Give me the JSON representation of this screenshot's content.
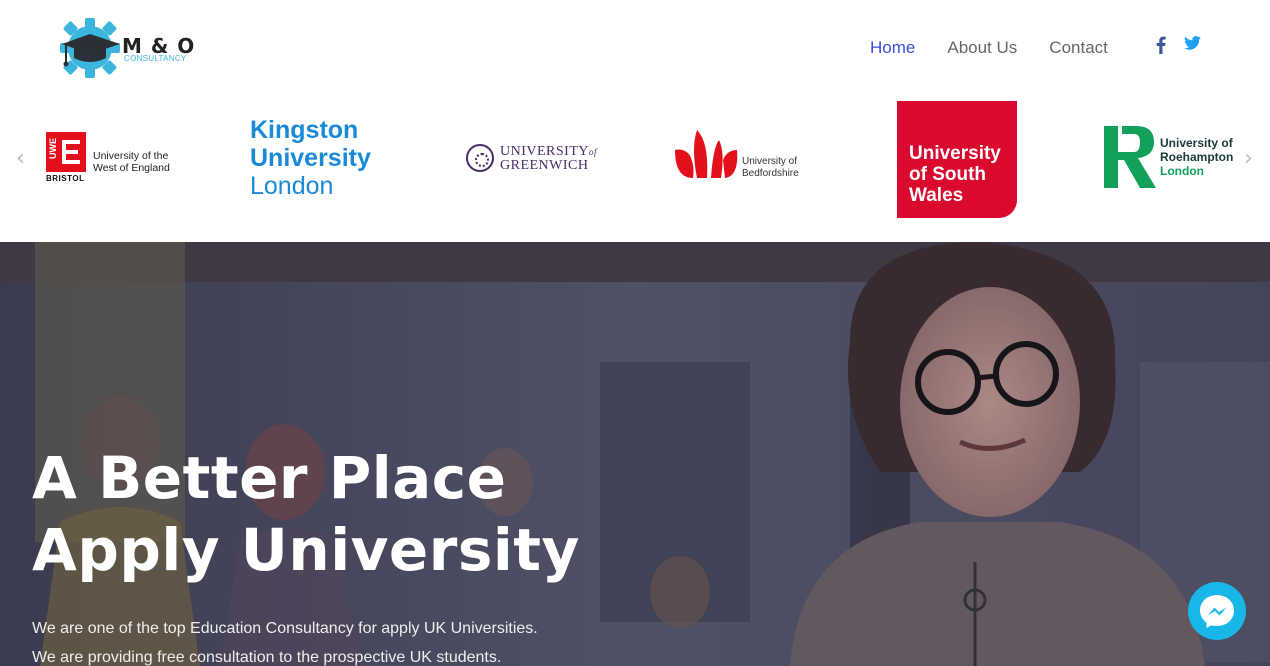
{
  "header": {
    "logo": {
      "title": "M & O",
      "subtitle": "CONSULTANCY"
    },
    "nav": [
      {
        "label": "Home",
        "active": true
      },
      {
        "label": "About Us",
        "active": false
      },
      {
        "label": "Contact",
        "active": false
      }
    ],
    "social": [
      {
        "icon": "facebook-icon",
        "color": "#3b5998"
      },
      {
        "icon": "twitter-icon",
        "color": "#1da1f2"
      }
    ]
  },
  "carousel": {
    "universities": [
      {
        "crest": "UWE",
        "city": "BRISTOL",
        "name_line1": "University of the",
        "name_line2": "West of England"
      },
      {
        "line1": "Kingston",
        "line2": "University",
        "line3": "London"
      },
      {
        "line1": "UNIVERSITY",
        "of": "of",
        "line2": "GREENWICH"
      },
      {
        "line1": "University of",
        "line2": "Bedfordshire"
      },
      {
        "line1": "University",
        "line2": "of South",
        "line3": "Wales"
      },
      {
        "line1": "University of",
        "line2": "Roehampton",
        "line3": "London"
      }
    ]
  },
  "hero": {
    "title_line1": "A Better Place",
    "title_line2": "Apply University",
    "text_line1": "We are one of the top Education Consultancy for apply UK Universities.",
    "text_line2": "We are providing free consultation to the prospective UK students."
  },
  "colors": {
    "nav_active": "#3a4fd6",
    "accent": "#39b5d9",
    "usw_red": "#d90a2e",
    "messenger": "#18b7e8"
  }
}
